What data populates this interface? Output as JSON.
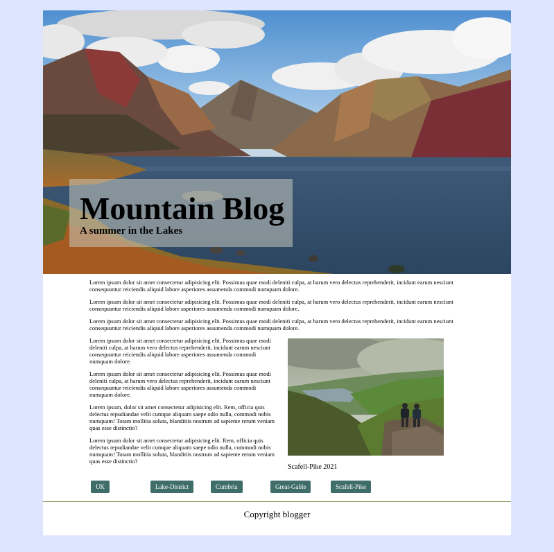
{
  "header": {
    "title": "Mountain Blog",
    "subtitle": "A summer in the Lakes"
  },
  "hero_image": {
    "description_icon": "lake-mountain-photo"
  },
  "article": {
    "full_paragraphs": [
      "Lorem ipsum dolor sit amet consectetur adipisicing elit. Possimus quae modi deleniti culpa, at harum vero delectus reprehenderit, incidunt earum nesciunt consequuntur reiciendis aliquid labore asperiores assumenda commodi numquam dolore.",
      "Lorem ipsum dolor sit amet consectetur adipisicing elit. Possimus quae modi deleniti culpa, at harum vero delectus reprehenderit, incidunt earum nesciunt consequuntur reiciendis aliquid labore asperiores assumenda commodi numquam dolore.",
      "Lorem ipsum dolor sit amet consectetur adipisicing elit. Possimus quae modi deleniti culpa, at harum vero delectus reprehenderit, incidunt earum nesciunt consequuntur reiciendis aliquid labore asperiores assumenda commodi numquam dolore."
    ],
    "side_paragraphs": [
      "Lorem ipsum dolor sit amet consectetur adipisicing elit. Possimus quae modi deleniti culpa, at harum vero delectus reprehenderit, incidunt earum nesciunt consequuntur reiciendis aliquid labore asperiores assumenda commodi numquam dolore.",
      "Lorem ipsum dolor sit amet consectetur adipisicing elit. Possimus quae modi deleniti culpa, at harum vero delectus reprehenderit, incidunt earum nesciunt consequuntur reiciendis aliquid labore asperiores assumenda commodi numquam dolore.",
      "Lorem ipsum, dolor sit amet consectetur adipisicing elit. Rem, officia quis delectus repudiandae velit cumque aliquam saepe odio nulla, commodi nobis numquam! Totam mollitia soluta, blanditiis nostrum ad sapiente rerum veniam quas esse distinctio?",
      "Lorem ipsum dolor sit amet consectetur adipisicing elit. Rem, officia quis delectus repudiandae velit cumque aliquam saepe odio nulla, commodi nobis numquam! Totam mollitia soluta, blanditiis nostrum ad sapiente rerum veniam quas esse distinctio?"
    ],
    "figure_caption": "Scafell-Pike 2021"
  },
  "tags": [
    "UK",
    "Lake-District",
    "Cumbria",
    "Great-Gable",
    "Scafell-Pike"
  ],
  "footer": {
    "copyright": "Copyright blogger"
  },
  "colors": {
    "page_background": "#dde5ff",
    "tag_background": "#3f6e6a",
    "rule": "#6b7a3a"
  }
}
